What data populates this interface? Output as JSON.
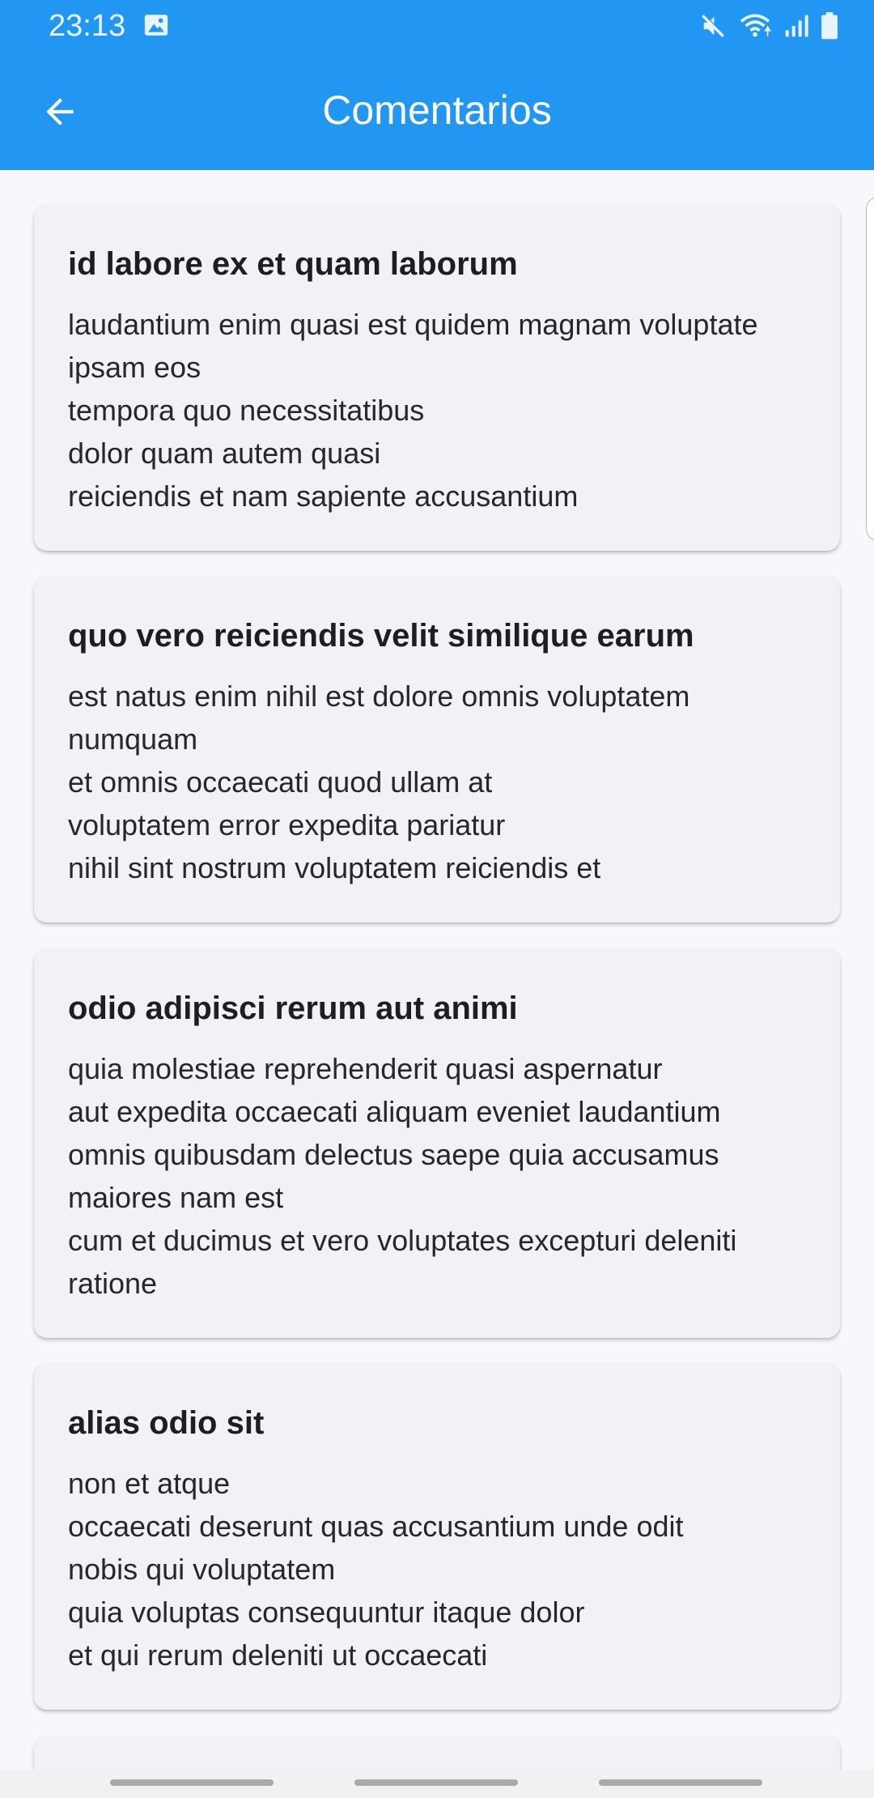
{
  "status_bar": {
    "time": "23:13",
    "icons": [
      "gallery-icon",
      "mute-icon",
      "wifi-icon",
      "signal-icon",
      "battery-icon"
    ]
  },
  "app_bar": {
    "title": "Comentarios",
    "back_icon": "arrow-left-icon",
    "background_color": "#2196f3"
  },
  "comments": [
    {
      "title": "id labore ex et quam laborum",
      "body": "laudantium enim quasi est quidem magnam voluptate\nipsam eos\ntempora quo necessitatibus\ndolor quam autem quasi\nreiciendis et nam sapiente accusantium"
    },
    {
      "title": "quo vero reiciendis velit similique earum",
      "body": "est natus enim nihil est dolore omnis voluptatem\nnumquam\net omnis occaecati quod ullam at\nvoluptatem error expedita pariatur\nnihil sint nostrum voluptatem reiciendis et"
    },
    {
      "title": "odio adipisci rerum aut animi",
      "body": "quia molestiae reprehenderit quasi aspernatur\naut expedita occaecati aliquam eveniet laudantium\nomnis quibusdam delectus saepe quia accusamus\nmaiores nam est\ncum et ducimus et vero voluptates excepturi deleniti\nratione"
    },
    {
      "title": "alias odio sit",
      "body": "non et atque\noccaecati deserunt quas accusantium unde odit\nnobis qui voluptatem\nquia voluptas consequuntur itaque dolor\net qui rerum deleniti ut occaecati"
    },
    {
      "title": "",
      "body": ""
    }
  ]
}
